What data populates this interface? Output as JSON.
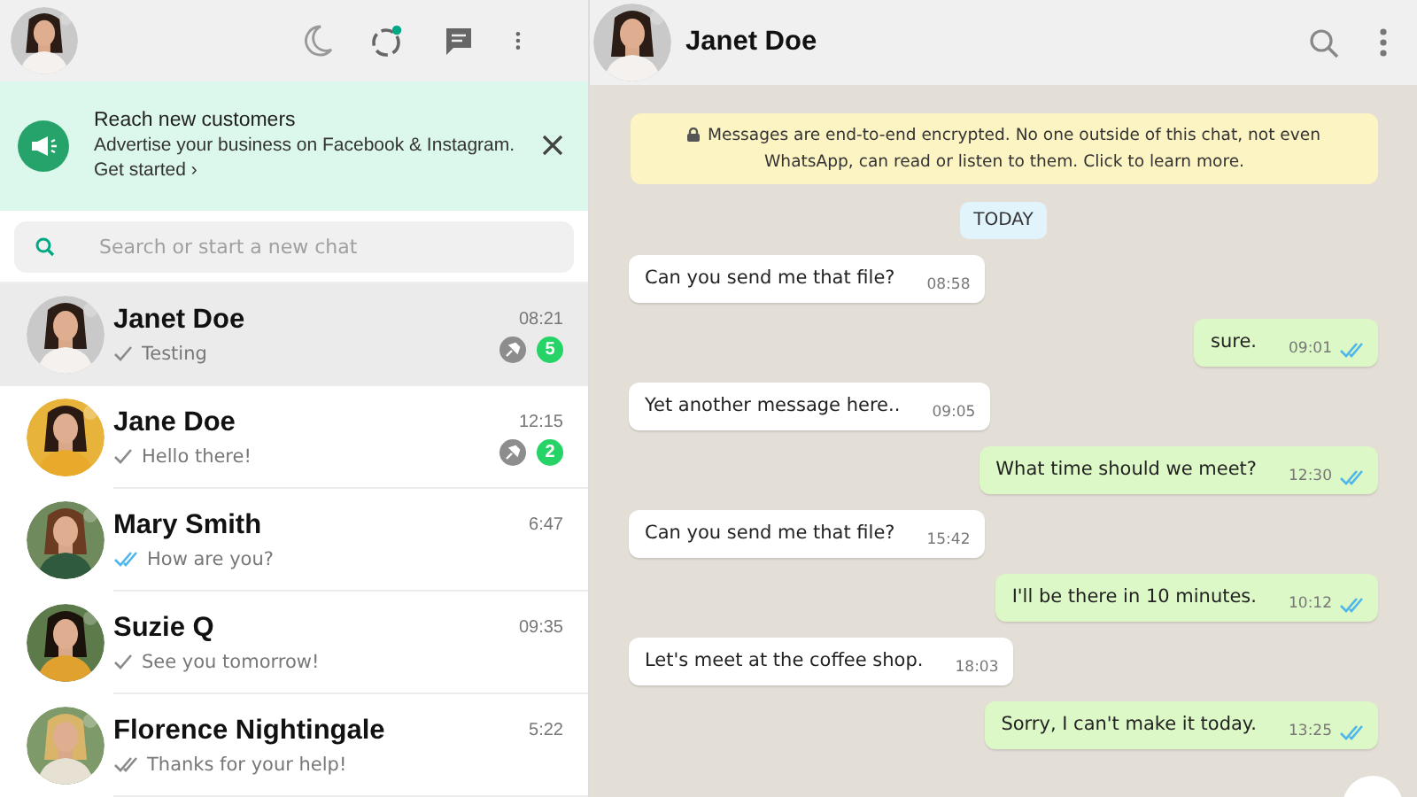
{
  "sidebar": {
    "banner": {
      "title": "Reach new customers",
      "text": "Advertise your business on Facebook & Instagram.",
      "link": "Get started ›"
    },
    "search": {
      "placeholder": "Search or start a new chat"
    },
    "chats": [
      {
        "name": "Janet Doe",
        "time": "08:21",
        "preview": "Testing",
        "double_check": false,
        "read": false,
        "pinned": true,
        "unread": "5",
        "selected": true
      },
      {
        "name": "Jane Doe",
        "time": "12:15",
        "preview": "Hello there!",
        "double_check": false,
        "read": false,
        "pinned": true,
        "unread": "2",
        "selected": false
      },
      {
        "name": "Mary Smith",
        "time": "6:47",
        "preview": "How are you?",
        "double_check": true,
        "read": true,
        "pinned": false,
        "selected": false
      },
      {
        "name": "Suzie Q",
        "time": "09:35",
        "preview": "See you tomorrow!",
        "double_check": false,
        "read": false,
        "pinned": false,
        "selected": false
      },
      {
        "name": "Florence Nightingale",
        "time": "5:22",
        "preview": "Thanks for your help!",
        "double_check": true,
        "read": false,
        "pinned": false,
        "selected": false
      }
    ]
  },
  "conversation": {
    "contact": {
      "name": "Janet Doe"
    },
    "encryption_notice": "Messages are end-to-end encrypted. No one outside of this chat, not even WhatsApp, can read or listen to them. Click to learn more.",
    "date_label": "TODAY",
    "messages": [
      {
        "outgoing": false,
        "text": "Can you send me that file?",
        "time": "08:58"
      },
      {
        "outgoing": true,
        "text": "sure.",
        "time": "09:01",
        "read": true
      },
      {
        "outgoing": false,
        "text": "Yet another message here..",
        "time": "09:05"
      },
      {
        "outgoing": true,
        "text": "What time should we meet?",
        "time": "12:30",
        "read": true
      },
      {
        "outgoing": false,
        "text": "Can you send me that file?",
        "time": "15:42"
      },
      {
        "outgoing": true,
        "text": "I'll be there in 10 minutes.",
        "time": "10:12",
        "read": true
      },
      {
        "outgoing": false,
        "text": "Let's meet at the coffee shop.",
        "time": "18:03"
      },
      {
        "outgoing": true,
        "text": "Sorry, I can't make it today.",
        "time": "13:25",
        "read": true
      }
    ]
  }
}
